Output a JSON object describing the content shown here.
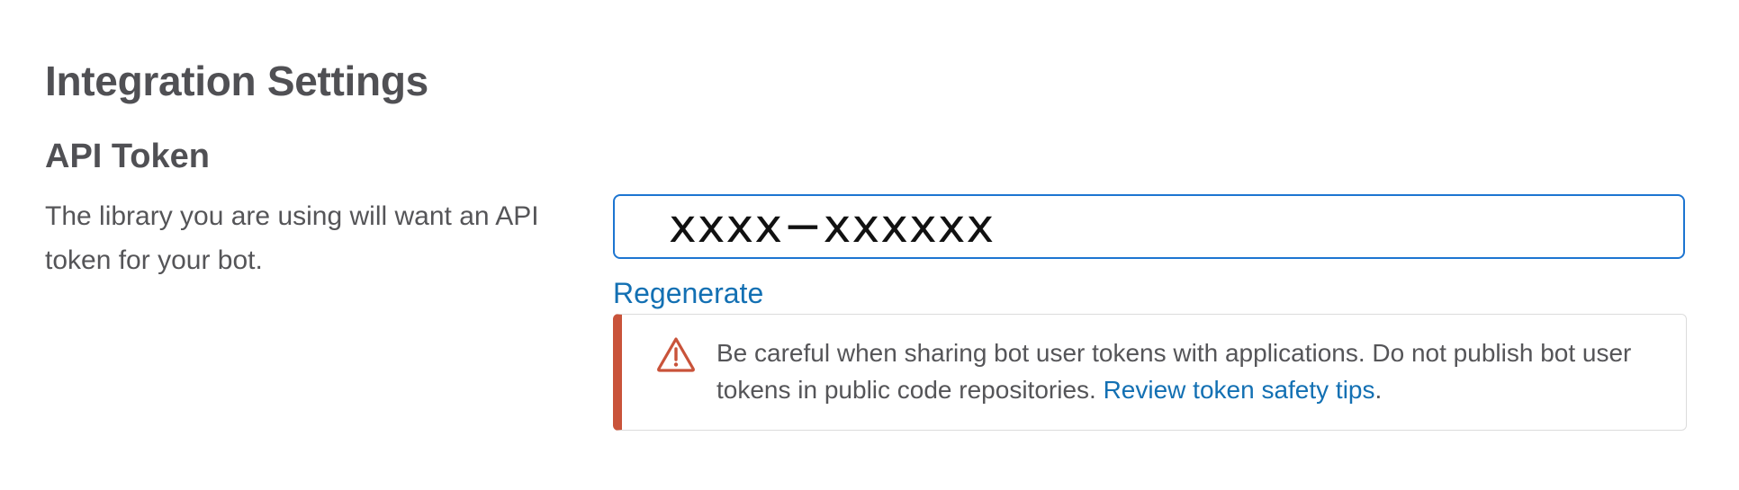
{
  "page": {
    "title": "Integration Settings"
  },
  "api_token": {
    "heading": "API Token",
    "description": "The library you are using will want an API token for your bot.",
    "token_value": "xxxx−xxxxxx",
    "regenerate_label": "Regenerate"
  },
  "warning": {
    "icon": "warning-triangle-icon",
    "text_before_link": "Be careful when sharing bot user tokens with applications. Do not publish bot user tokens in public code repositories. ",
    "link_label": "Review token safety tips",
    "text_after_link": ".",
    "accent_color": "#c9533a"
  },
  "colors": {
    "input_border": "#1d75d1",
    "link": "#1370b3"
  }
}
